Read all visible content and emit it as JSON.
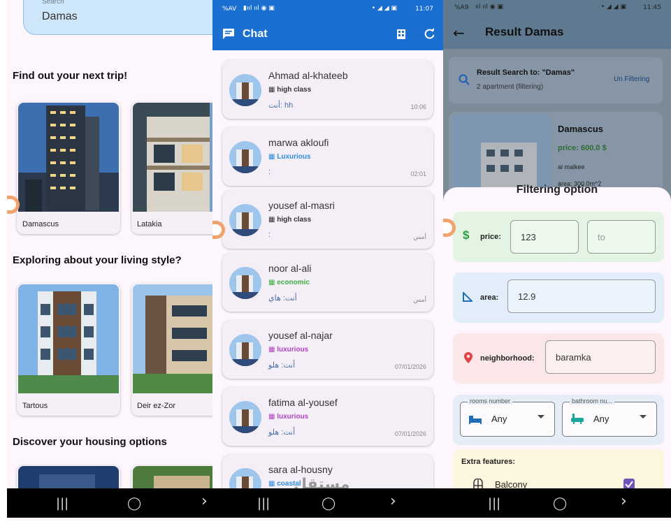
{
  "left": {
    "search": {
      "label": "Search",
      "value": "Damas"
    },
    "sections": [
      {
        "title": "Find out your next trip!",
        "cards": [
          "Damascus",
          "Latakia"
        ]
      },
      {
        "title": "Exploring about your living style?",
        "cards": [
          "Tartous",
          "Deir ez-Zor"
        ]
      },
      {
        "title": "Discover your housing options",
        "cards": [
          "",
          ""
        ]
      }
    ],
    "nav": {
      "recents": "|||",
      "home": "◯",
      "back": "›"
    }
  },
  "mid": {
    "status": {
      "left": "%AV",
      "right": "11:07"
    },
    "appbar": {
      "title": "Chat"
    },
    "chats": [
      {
        "name": "Ahmad al-khateeb",
        "class": "high class",
        "class_color": "#333333",
        "message": "أنت: hh",
        "time": "10:06"
      },
      {
        "name": "marwa akloufi",
        "class": "Luxurious",
        "class_color": "#2f8ce0",
        "message": ":",
        "time": "02:01"
      },
      {
        "name": "yousef al-masri",
        "class": "high class",
        "class_color": "#333333",
        "message": ":",
        "time": "أمس"
      },
      {
        "name": "noor al-ali",
        "class": "economic",
        "class_color": "#3cb043",
        "message": "أنت: هاي",
        "time": "أمس"
      },
      {
        "name": "yousef al-najar",
        "class": "luxurious",
        "class_color": "#b342c4",
        "message": "أنت: هلو",
        "time": "07/01/2026"
      },
      {
        "name": "fatima al-yousef",
        "class": "luxurious",
        "class_color": "#b342c4",
        "message": "أنت: هلو",
        "time": "07/01/2026"
      },
      {
        "name": "sara al-housny",
        "class": "coastal",
        "class_color": "#2f8ce0",
        "message": "",
        "time": ""
      }
    ],
    "nav": {
      "recents": "|||",
      "home": "◯",
      "back": "›"
    },
    "watermark": "مستقل mostaql.com"
  },
  "right": {
    "status": {
      "left": "%A9",
      "right": "11:45"
    },
    "appbar": {
      "title": "Result Damas"
    },
    "result": {
      "heading": "Result Search to: \"Damas\"",
      "sub": "2 apartment (filtering)",
      "unfilter": "Un Filtering"
    },
    "property": {
      "city": "Damascus",
      "price": "price: 600.0 $",
      "district": "al malkee",
      "area": "area: 300.0m^2"
    },
    "filter": {
      "title": "Filtering option",
      "price_label": "price:",
      "price_from": "123",
      "price_to_placeholder": "to",
      "area_label": "area:",
      "area_value": "12.9",
      "neighborhood_label": "neighborhood:",
      "neighborhood_value": "baramka",
      "rooms_label": "rooms number",
      "rooms_value": "Any",
      "bathroom_label": "bathroom nu...",
      "bathroom_value": "Any",
      "extras_label": "Extra features:",
      "balcony_label": "Balcony",
      "balcony_checked": true
    },
    "colors": {
      "price_bg": "#e3f4e3",
      "area_bg": "#e1eefa",
      "neigh_bg": "#fbe7e7",
      "dd_bg": "#e5edf7",
      "extras_bg": "#fdf6df"
    },
    "nav": {
      "recents": "|||",
      "home": "◯",
      "back": "›"
    }
  }
}
